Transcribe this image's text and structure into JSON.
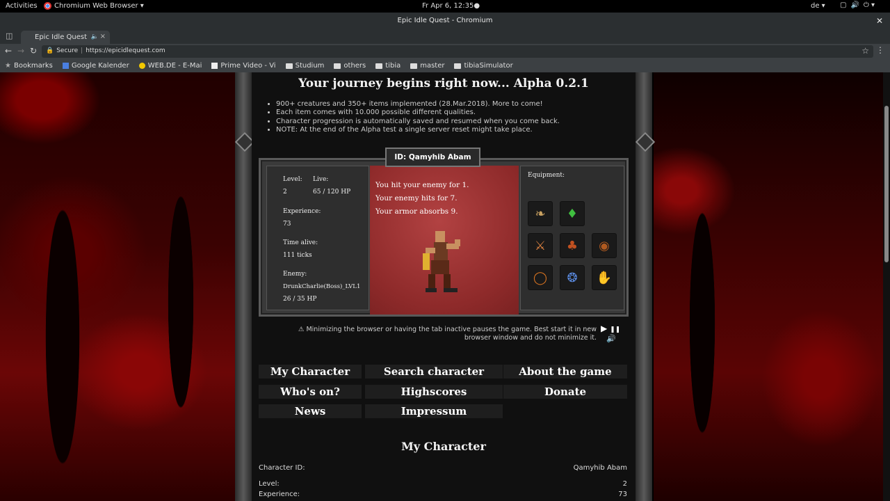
{
  "os_bar": {
    "activities": "Activities",
    "app_name": "Chromium Web Browser ▾",
    "clock": "Fr Apr  6, 12:35●",
    "language": "de ▾",
    "tray": [
      "▢",
      "🔊",
      "⏻ ▾"
    ]
  },
  "window": {
    "title": "Epic Idle Quest - Chromium",
    "close": "✕"
  },
  "tab": {
    "title": "Epic Idle Quest",
    "audio_icon": "🔈",
    "close": "×"
  },
  "address": {
    "secure_label": "Secure",
    "separator": "|",
    "url": "https://epicidlequest.com"
  },
  "bookmarks": [
    {
      "label": "Bookmarks",
      "icon": "star-icon"
    },
    {
      "label": "Google Kalender",
      "icon": "calendar-icon"
    },
    {
      "label": "WEB.DE - E-Mai",
      "icon": "webde-icon"
    },
    {
      "label": "Prime Video - Vi",
      "icon": "prime-icon"
    },
    {
      "label": "Studium",
      "icon": "folder-icon"
    },
    {
      "label": "others",
      "icon": "folder-icon"
    },
    {
      "label": "tibia",
      "icon": "folder-icon"
    },
    {
      "label": "master",
      "icon": "folder-icon"
    },
    {
      "label": "tibiaSimulator",
      "icon": "folder-icon"
    }
  ],
  "page": {
    "headline": "Your journey begins right now... Alpha 0.2.1",
    "bullets": [
      "900+ creatures and 350+ items implemented (28.Mar.2018). More to come!",
      "Each item comes with 10.000 possible different qualities.",
      "Character progression is automatically saved and resumed when you come back.",
      "NOTE: At the end of the Alpha test a single server reset might take place."
    ],
    "character_id_tab": "ID: Qamyhib Abam",
    "stats": {
      "level_label": "Level:",
      "level": "2",
      "live_label": "Live:",
      "live": "65 / 120 HP",
      "experience_label": "Experience:",
      "experience": "73",
      "time_alive_label": "Time alive:",
      "time_alive": "111 ticks",
      "enemy_label": "Enemy:",
      "enemy_name": "DrunkCharlie(Boss)_LVL1",
      "enemy_hp": "26 / 35 HP"
    },
    "combat_log": [
      "You hit your enemy for 1.",
      "Your enemy hits for 7.",
      "Your armor absorbs 9."
    ],
    "equipment": {
      "label": "Equipment:",
      "slots": [
        {
          "name": "amulet-icon",
          "glyph": "❧",
          "color": "#c8a060"
        },
        {
          "name": "helmet-icon",
          "glyph": "♦",
          "color": "#3fbf3f"
        },
        {
          "name": "club-icon",
          "glyph": "⚔",
          "color": "#d98040"
        },
        {
          "name": "armor-icon",
          "glyph": "♣",
          "color": "#c05020"
        },
        {
          "name": "shield-icon",
          "glyph": "◉",
          "color": "#b05a20"
        },
        {
          "name": "ring-icon",
          "glyph": "◯",
          "color": "#d07020"
        },
        {
          "name": "boots-icon",
          "glyph": "❂",
          "color": "#5a8ae0"
        },
        {
          "name": "gloves-icon",
          "glyph": "✋",
          "color": "#d8a040"
        }
      ]
    },
    "warning": "⚠ Minimizing the browser or having the tab inactive pauses the game. Best start it in new browser window and do not minimize it.",
    "controls": {
      "play": "▶",
      "pause": "❚❚",
      "sound": "🔊"
    },
    "nav": [
      "My Character",
      "Search character",
      "About the game",
      "Who's on?",
      "Highscores",
      "Donate",
      "News",
      "Impressum"
    ],
    "my_character": {
      "heading": "My Character",
      "rows": [
        {
          "label": "Character ID:",
          "value": "Qamyhib Abam"
        },
        {
          "label": "Level:",
          "value": "2"
        },
        {
          "label": "Experience:",
          "value": "73"
        }
      ]
    }
  }
}
